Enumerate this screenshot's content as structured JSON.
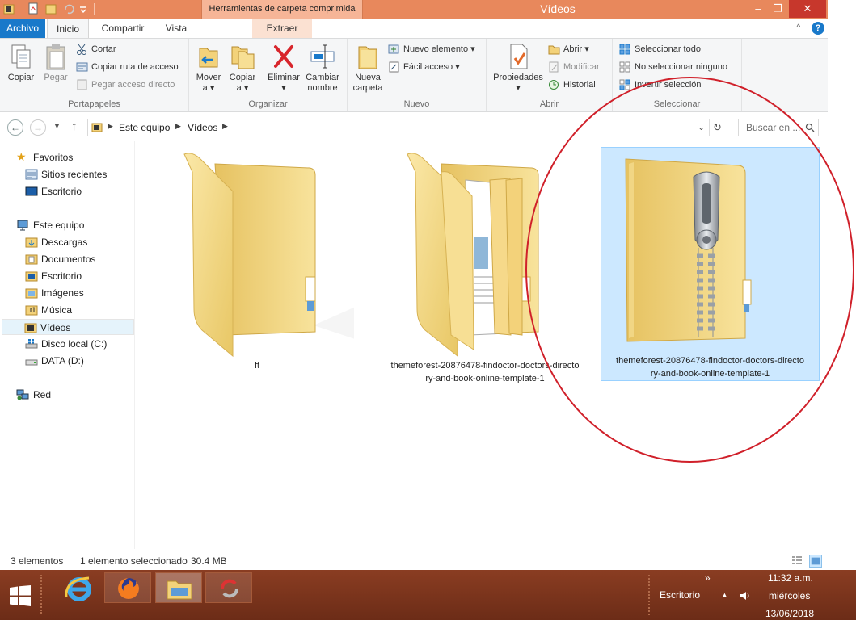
{
  "titlebar": {
    "context_tab": "Herramientas de carpeta comprimida",
    "window_title": "Vídeos",
    "minimize": "–",
    "maximize": "❐",
    "close": "✕"
  },
  "tabs": {
    "file": "Archivo",
    "home": "Inicio",
    "share": "Compartir",
    "view": "Vista",
    "extract": "Extraer"
  },
  "ribbon": {
    "clipboard": {
      "label": "Portapapeles",
      "copy": "Copiar",
      "paste": "Pegar",
      "cut": "Cortar",
      "copy_path": "Copiar ruta de acceso",
      "paste_shortcut": "Pegar acceso directo"
    },
    "organize": {
      "label": "Organizar",
      "move_to_1": "Mover",
      "move_to_2": "a",
      "copy_to_1": "Copiar",
      "copy_to_2": "a",
      "delete": "Eliminar",
      "rename_1": "Cambiar",
      "rename_2": "nombre"
    },
    "new": {
      "label": "Nuevo",
      "new_folder_1": "Nueva",
      "new_folder_2": "carpeta",
      "new_item": "Nuevo elemento",
      "easy_access": "Fácil acceso"
    },
    "open": {
      "label": "Abrir",
      "properties": "Propiedades",
      "open": "Abrir",
      "edit": "Modificar",
      "history": "Historial"
    },
    "select": {
      "label": "Seleccionar",
      "select_all": "Seleccionar todo",
      "select_none": "No seleccionar ninguno",
      "invert": "Invertir selección"
    }
  },
  "address": {
    "crumbs": [
      "Este equipo",
      "Vídeos"
    ],
    "search_placeholder": "Buscar en ..."
  },
  "navpane": {
    "favorites": "Favoritos",
    "recent": "Sitios recientes",
    "desktop_fav": "Escritorio",
    "this_pc": "Este equipo",
    "downloads": "Descargas",
    "documents": "Documentos",
    "desktop": "Escritorio",
    "pictures": "Imágenes",
    "music": "Música",
    "videos": "Vídeos",
    "local_disk": "Disco local (C:)",
    "data_disk": "DATA (D:)",
    "network": "Red"
  },
  "files": [
    {
      "name": "ft",
      "type": "folder"
    },
    {
      "name": "themeforest-20876478-findoctor-doctors-directory-and-book-online-template-1",
      "line1": "themeforest-20876478-findoctor-doctors-directo",
      "line2": "ry-and-book-online-template-1",
      "type": "folder"
    },
    {
      "name": "themeforest-20876478-findoctor-doctors-directory-and-book-online-template-1",
      "line1": "themeforest-20876478-findoctor-doctors-directo",
      "line2": "ry-and-book-online-template-1",
      "type": "zip",
      "selected": true
    }
  ],
  "status": {
    "count": "3 elementos",
    "selection": "1 elemento seleccionado",
    "size": "30.4 MB"
  },
  "taskbar": {
    "desktop_label": "Escritorio",
    "chevron": "»",
    "time": "11:32 a.m.",
    "day": "miércoles",
    "date": "13/06/2018"
  },
  "colors": {
    "titlebar": "#e8885c",
    "accent": "#1979ca",
    "selection": "#cce8ff",
    "annotation": "#d0202a"
  }
}
